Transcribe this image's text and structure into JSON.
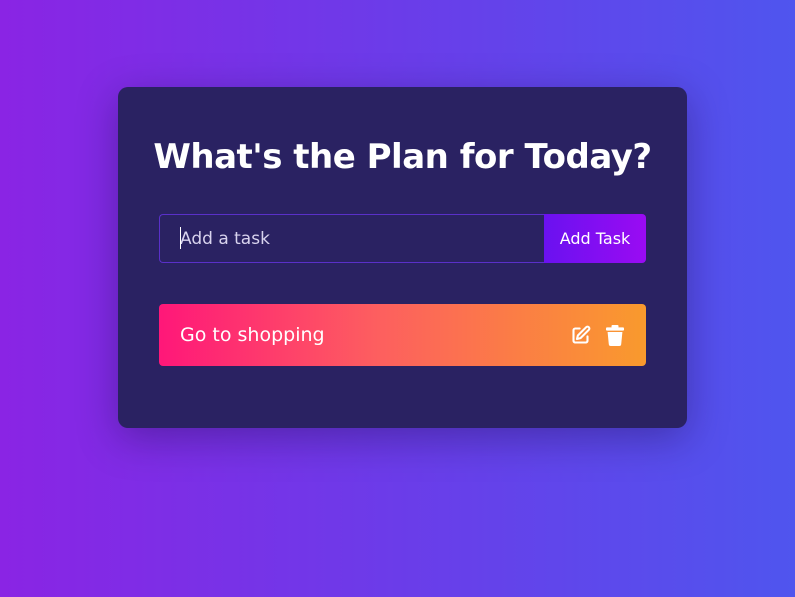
{
  "app": {
    "title": "What's the Plan for Today?"
  },
  "form": {
    "input_placeholder": "Add a task",
    "input_value": "",
    "add_label": "Add Task"
  },
  "todos": [
    {
      "text": "Go to shopping",
      "edit_icon": "edit-icon",
      "delete_icon": "trash-icon"
    }
  ],
  "colors": {
    "background_start": "#8a24e4",
    "background_end": "#4f55ee",
    "card": "#2a2262",
    "button_start": "#6a11f0",
    "button_end": "#9a0bf3",
    "todo_start": "#ff1779",
    "todo_end": "#f99a2d"
  }
}
